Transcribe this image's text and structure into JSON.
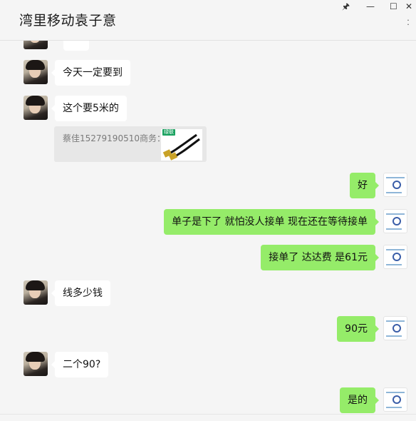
{
  "window": {
    "title": "湾里移动袁子意",
    "controls": {
      "pin": "🖈",
      "minimize": "—",
      "maximize": "☐",
      "close": "✕"
    },
    "more_icon": "more-vertical-icon"
  },
  "colors": {
    "my_bubble": "#95ec69",
    "their_bubble": "#ffffff",
    "background": "#f5f5f5"
  },
  "messages": [
    {
      "side": "left",
      "text": ""
    },
    {
      "side": "left",
      "text": "今天一定要到"
    },
    {
      "side": "left",
      "text": "这个要5米的"
    },
    {
      "side": "left",
      "quote": {
        "text": "蔡佳15279190510商务：",
        "badge": "绿联",
        "image": "hdmi-cable-image"
      }
    },
    {
      "side": "right",
      "text": "好"
    },
    {
      "side": "right",
      "text": "单子是下了 就怕没人接单 现在还在等待接单"
    },
    {
      "side": "right",
      "text": "接单了 达达费 是61元"
    },
    {
      "side": "left",
      "text": "线多少钱"
    },
    {
      "side": "right",
      "text": "90元"
    },
    {
      "side": "left",
      "text": "二个90?"
    },
    {
      "side": "right",
      "text": "是的"
    }
  ]
}
